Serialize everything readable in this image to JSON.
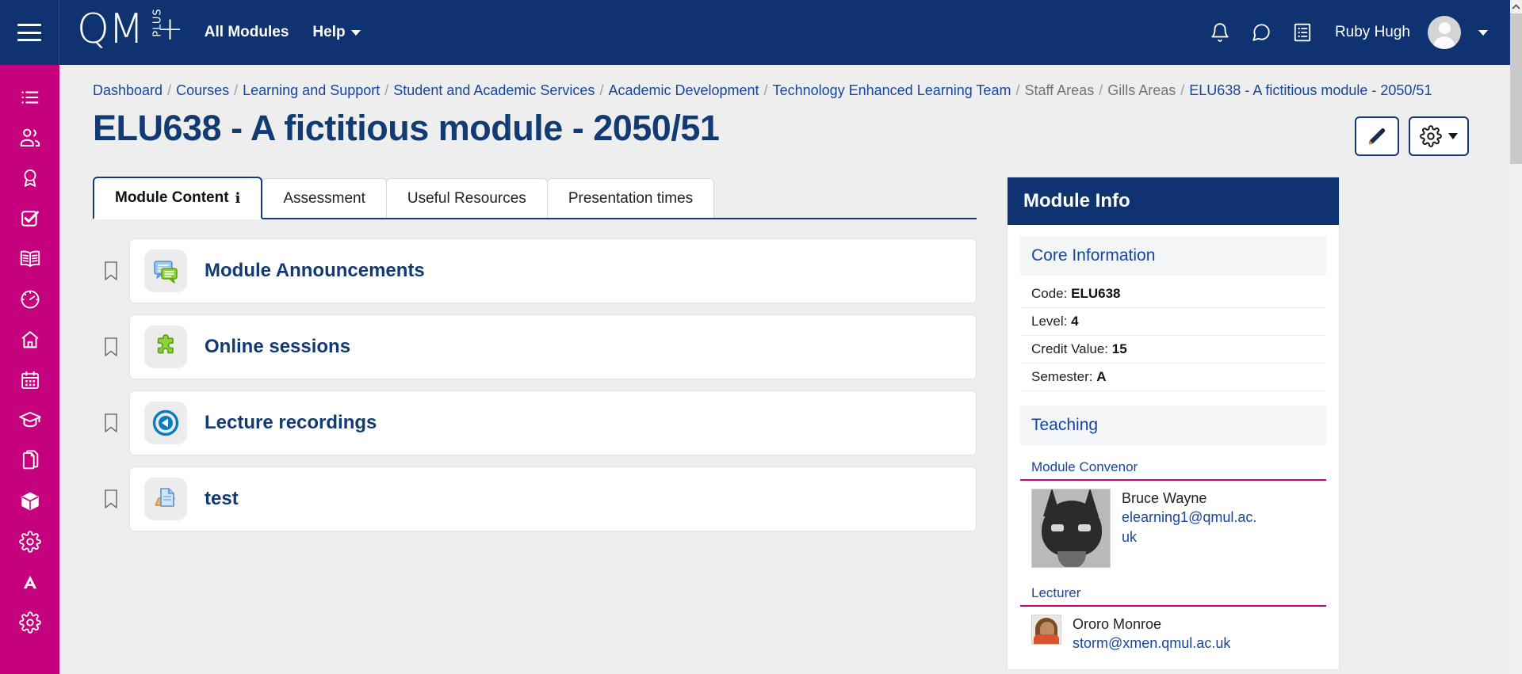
{
  "navbar": {
    "menu_toggle": "menu-toggle",
    "brand": {
      "main": "QM",
      "plus_word": "PLUS",
      "plus_glyph": "+"
    },
    "links": [
      {
        "label": "All Modules",
        "has_caret": false
      },
      {
        "label": "Help",
        "has_caret": true
      }
    ],
    "icons": [
      "notifications-bell-icon",
      "messages-bubble-icon",
      "activity-log-icon"
    ],
    "user": {
      "name": "Ruby Hugh",
      "avatar": "default-user-avatar"
    },
    "background_color": "#0f3270"
  },
  "sidebar": {
    "background_color": "#c6017d",
    "items": [
      {
        "icon": "list-icon",
        "label": "Module index"
      },
      {
        "icon": "participants-icon",
        "label": "Participants"
      },
      {
        "icon": "badges-icon",
        "label": "Badges"
      },
      {
        "icon": "completion-check-icon",
        "label": "Completion"
      },
      {
        "icon": "open-book-icon",
        "label": "Reading list"
      },
      {
        "icon": "speedometer-icon",
        "label": "Analytics"
      },
      {
        "icon": "home-icon",
        "label": "Home"
      },
      {
        "icon": "calendar-icon",
        "label": "Calendar"
      },
      {
        "icon": "graduation-cap-icon",
        "label": "Grades"
      },
      {
        "icon": "documents-icon",
        "label": "Files"
      },
      {
        "icon": "cube-icon",
        "label": "Resources"
      },
      {
        "icon": "gear-icon",
        "label": "Settings"
      },
      {
        "icon": "ally-a-icon",
        "label": "Ally"
      },
      {
        "icon": "gear-icon",
        "label": "Administration"
      }
    ]
  },
  "breadcrumb": [
    {
      "label": "Dashboard",
      "link": true
    },
    {
      "label": "Courses",
      "link": true
    },
    {
      "label": "Learning and Support",
      "link": true
    },
    {
      "label": "Student and Academic Services",
      "link": true
    },
    {
      "label": "Academic Development",
      "link": true
    },
    {
      "label": "Technology Enhanced Learning Team",
      "link": true
    },
    {
      "label": "Staff Areas",
      "link": false
    },
    {
      "label": "Gills Areas",
      "link": false
    },
    {
      "label": "ELU638 - A fictitious module - 2050/51",
      "link": true
    }
  ],
  "page": {
    "title": "ELU638 - A fictitious module - 2050/51",
    "actions": [
      {
        "icon": "pencil-edit-icon",
        "label": "Edit mode"
      },
      {
        "icon": "gear-icon",
        "label": "Course settings menu",
        "caret": true
      }
    ]
  },
  "tabs": [
    {
      "label": "Module Content",
      "active": true,
      "info_icon": "info-icon",
      "info_glyph": "i"
    },
    {
      "label": "Assessment",
      "active": false
    },
    {
      "label": "Useful Resources",
      "active": false
    },
    {
      "label": "Presentation times",
      "active": false
    }
  ],
  "module_items": [
    {
      "name": "Module Announcements",
      "icon": "forum-icon",
      "bookmark": "bookmark-icon"
    },
    {
      "name": "Online sessions",
      "icon": "external-tool-puzzle-icon",
      "bookmark": "bookmark-icon"
    },
    {
      "name": "Lecture recordings",
      "icon": "media-play-icon",
      "bookmark": "bookmark-icon"
    },
    {
      "name": "test",
      "icon": "assignment-file-icon",
      "bookmark": "bookmark-icon"
    }
  ],
  "module_info": {
    "panel_title": "Module Info",
    "core": {
      "heading": "Core Information",
      "rows": [
        {
          "label": "Code:",
          "value": "ELU638"
        },
        {
          "label": "Level:",
          "value": "4"
        },
        {
          "label": "Credit Value:",
          "value": "15"
        },
        {
          "label": "Semester:",
          "value": "A"
        }
      ]
    },
    "teaching": {
      "heading": "Teaching",
      "roles": [
        {
          "title": "Module Convenor",
          "people": [
            {
              "name": "Bruce Wayne",
              "email": "elearning1@qmul.ac.uk",
              "avatar": "batman-avatar",
              "size": "large"
            }
          ]
        },
        {
          "title": "Lecturer",
          "people": [
            {
              "name": "Ororo Monroe",
              "email": "storm@xmen.qmul.ac.uk",
              "avatar": "storm-avatar",
              "size": "small"
            }
          ]
        }
      ]
    }
  },
  "scrollbar": {
    "up_arrow": "scroll-up-arrow-icon"
  },
  "colors": {
    "navy": "#0f3270",
    "magenta": "#c6017d",
    "link_blue": "#16469d",
    "title_blue": "#123a73",
    "page_bg": "#eeeeee"
  }
}
